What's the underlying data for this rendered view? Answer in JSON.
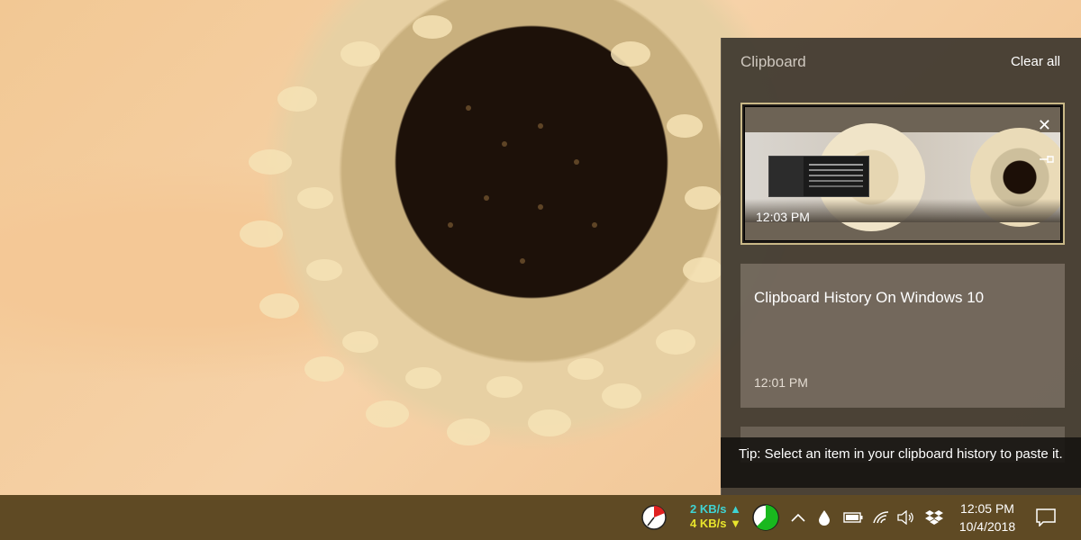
{
  "clipboard": {
    "title": "Clipboard",
    "clear_all_label": "Clear all",
    "items": [
      {
        "type": "image",
        "time": "12:03 PM",
        "selected": true
      },
      {
        "type": "text",
        "text": "Clipboard History On Windows 10",
        "time": "12:01 PM"
      }
    ],
    "tip": "Tip: Select an item in your clipboard history to paste it."
  },
  "taskbar": {
    "network": {
      "upload": "2 KB/s",
      "upload_arrow": "▲",
      "download": "4 KB/s",
      "download_arrow": "▼"
    },
    "clock": {
      "time": "12:05 PM",
      "date": "10/4/2018"
    },
    "icons": [
      "pie-indicator-icon",
      "green-circle-icon",
      "chevron-up-icon",
      "drop-icon",
      "battery-icon",
      "wifi-icon",
      "volume-icon",
      "dropbox-icon",
      "notifications-icon"
    ]
  },
  "colors": {
    "taskbar": "#5f4a24",
    "selected_border": "#c9b887",
    "upload": "#3fd3d3",
    "download": "#e9e52c"
  }
}
